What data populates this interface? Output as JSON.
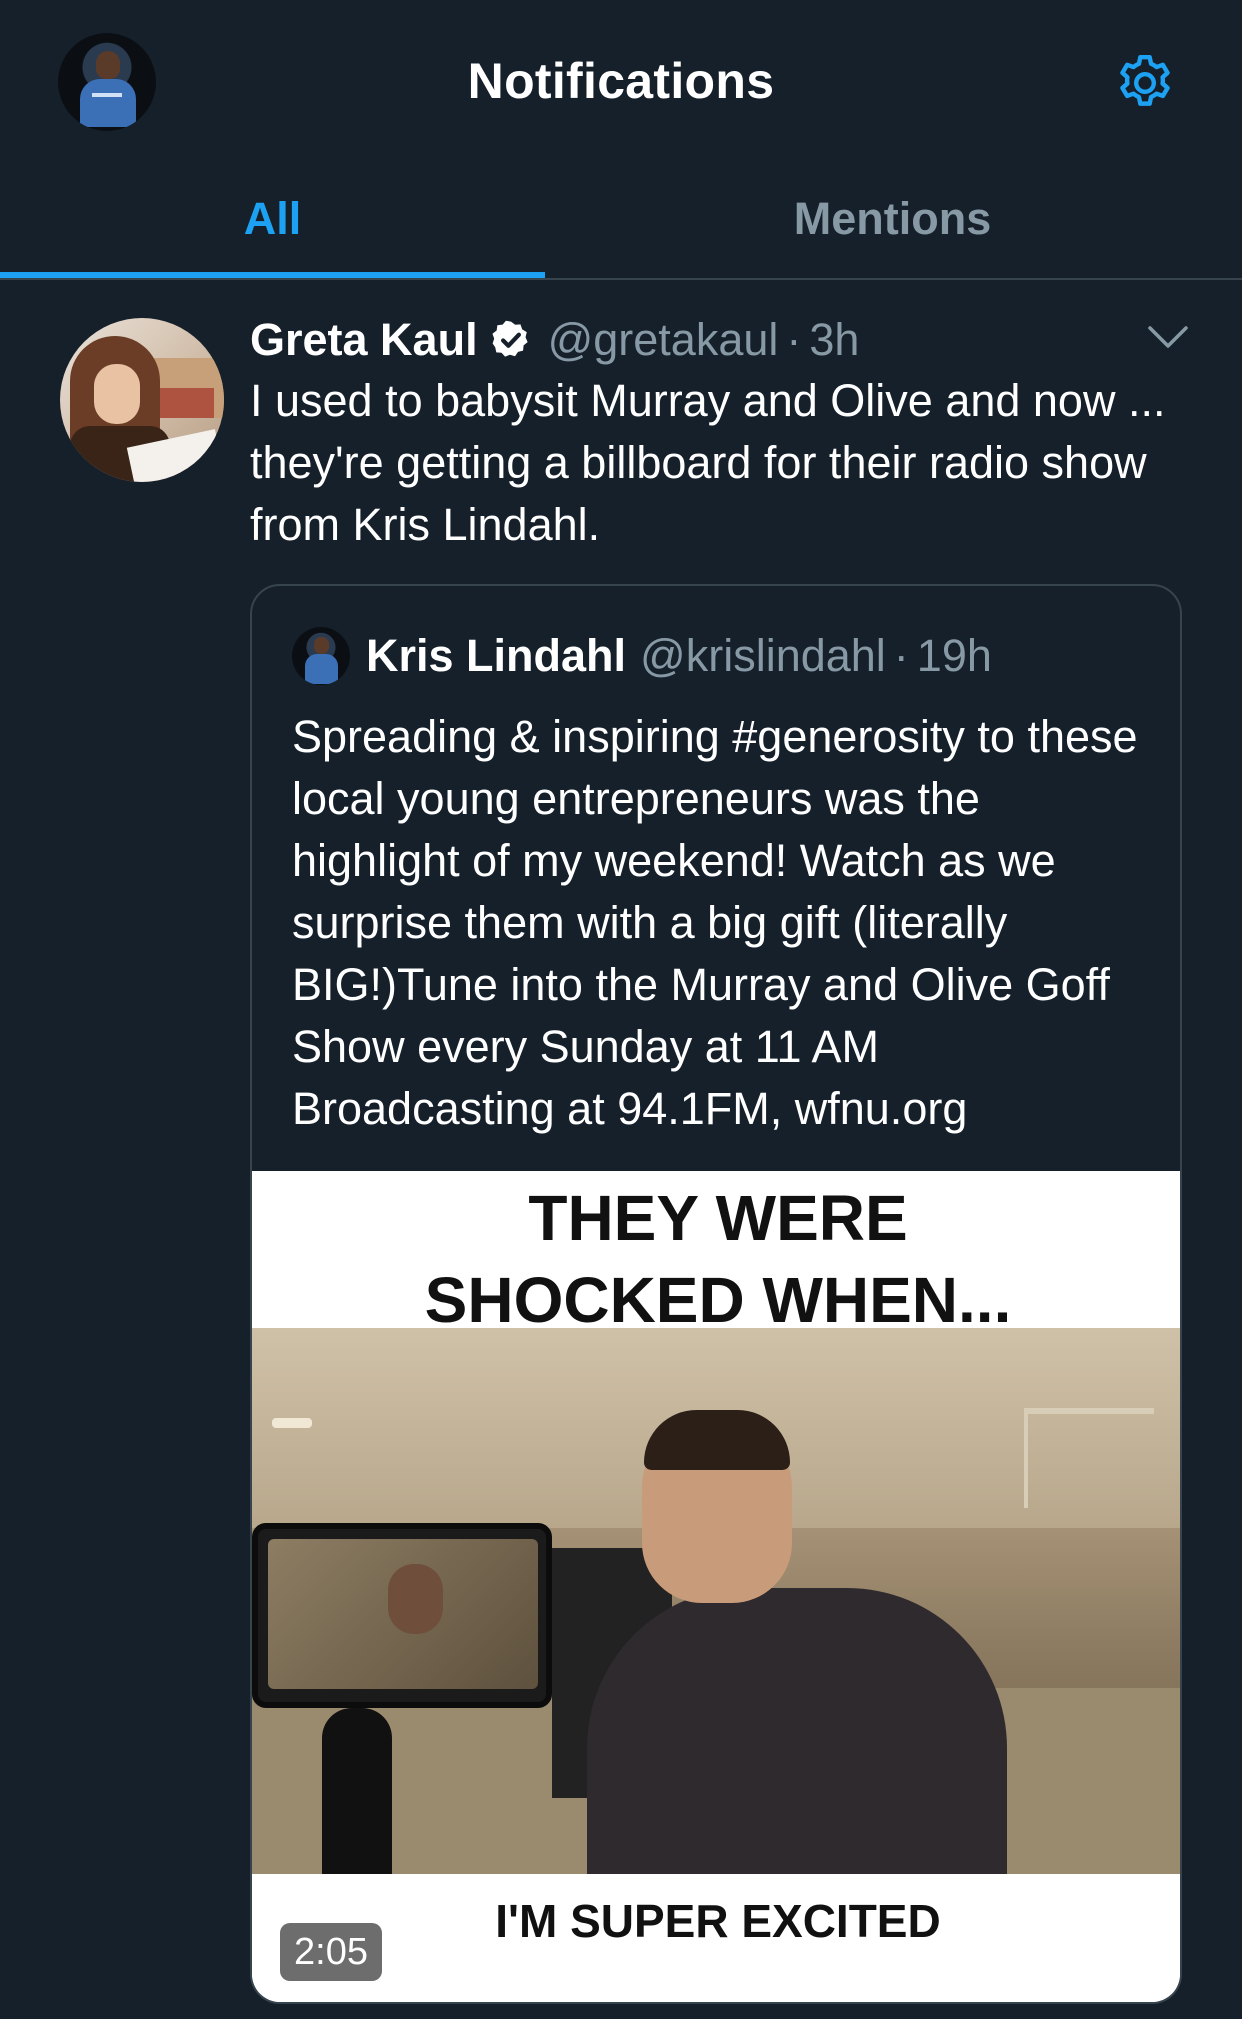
{
  "header": {
    "title": "Notifications",
    "avatar_icon": "user-avatar",
    "settings_icon": "gear-icon",
    "accent_color": "#1da1f2"
  },
  "tabs": [
    {
      "label": "All",
      "selected": true
    },
    {
      "label": "Mentions",
      "selected": false
    }
  ],
  "tweet": {
    "author_name": "Greta Kaul",
    "verified": true,
    "handle": "@gretakaul",
    "separator": "·",
    "time": "3h",
    "text": "I used to babysit Murray and Olive and now ... they're getting a billboard for their radio show from Kris Lindahl.",
    "menu_icon": "chevron-down-icon",
    "quoted": {
      "author_name": "Kris Lindahl",
      "handle": "@krislindahl",
      "separator": "·",
      "time": "19h",
      "text": "Spreading & inspiring #generosity to these local young entrepreneurs was the highlight of my weekend! Watch as we surprise them with a big gift (literally BIG!)Tune into the Murray and Olive Goff Show every Sunday at 11 AM Broadcasting at 94.1FM, wfnu.org",
      "video": {
        "caption_top_line1": "THEY WERE",
        "caption_top_line2": "SHOCKED WHEN...",
        "caption_bottom": "I'M SUPER EXCITED",
        "duration": "2:05"
      }
    }
  }
}
